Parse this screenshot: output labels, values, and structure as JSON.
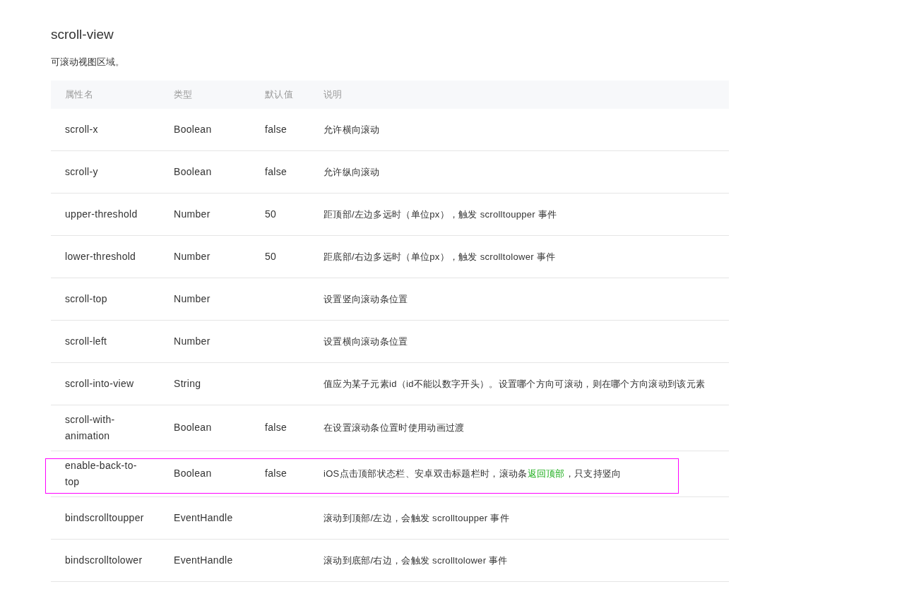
{
  "title": "scroll-view",
  "intro": "可滚动视图区域。",
  "table": {
    "columns": [
      "属性名",
      "类型",
      "默认值",
      "说明"
    ],
    "rows": [
      {
        "name": "scroll-x",
        "type": "Boolean",
        "default": "false",
        "description": [
          {
            "kind": "plain",
            "text": "允许横向滚动"
          }
        ],
        "highlighted": false
      },
      {
        "name": "scroll-y",
        "type": "Boolean",
        "default": "false",
        "description": [
          {
            "kind": "plain",
            "text": "允许纵向滚动"
          }
        ],
        "highlighted": false
      },
      {
        "name": "upper-threshold",
        "type": "Number",
        "default": "50",
        "description": [
          {
            "kind": "plain",
            "text": "距顶部/左边多远时（单位px），触发 scrolltoupper 事件"
          }
        ],
        "highlighted": false
      },
      {
        "name": "lower-threshold",
        "type": "Number",
        "default": "50",
        "description": [
          {
            "kind": "plain",
            "text": "距底部/右边多远时（单位px），触发 scrolltolower 事件"
          }
        ],
        "highlighted": false
      },
      {
        "name": "scroll-top",
        "type": "Number",
        "description": [
          {
            "kind": "plain",
            "text": "设置竖向滚动条位置"
          }
        ],
        "highlighted": false
      },
      {
        "name": "scroll-left",
        "type": "Number",
        "description": [
          {
            "kind": "plain",
            "text": "设置横向滚动条位置"
          }
        ],
        "highlighted": false
      },
      {
        "name": "scroll-into-view",
        "type": "String",
        "description": [
          {
            "kind": "plain",
            "text": "值应为某子元素id（id不能以数字开头）。设置哪个方向可滚动，则在哪个方向滚动到该元素"
          }
        ],
        "highlighted": false
      },
      {
        "name": "scroll-with-animation",
        "type": "Boolean",
        "default": "false",
        "description": [
          {
            "kind": "plain",
            "text": "在设置滚动条位置时使用动画过渡"
          }
        ],
        "highlighted": false
      },
      {
        "name": "enable-back-to-top",
        "type": "Boolean",
        "default": "false",
        "description": [
          {
            "kind": "plain",
            "text": "iOS点击顶部状态栏、安卓双击标题栏时，滚动条"
          },
          {
            "kind": "highlight",
            "text": "返回顶部"
          },
          {
            "kind": "plain",
            "text": "，只支持竖向"
          }
        ],
        "highlighted": true
      },
      {
        "name": "bindscrolltoupper",
        "type": "EventHandle",
        "description": [
          {
            "kind": "plain",
            "text": "滚动到顶部/左边，会触发 scrolltoupper 事件"
          }
        ],
        "highlighted": false
      },
      {
        "name": "bindscrolltolower",
        "type": "EventHandle",
        "description": [
          {
            "kind": "plain",
            "text": "滚动到底部/右边，会触发 scrolltolower 事件"
          }
        ],
        "highlighted": false
      }
    ]
  }
}
